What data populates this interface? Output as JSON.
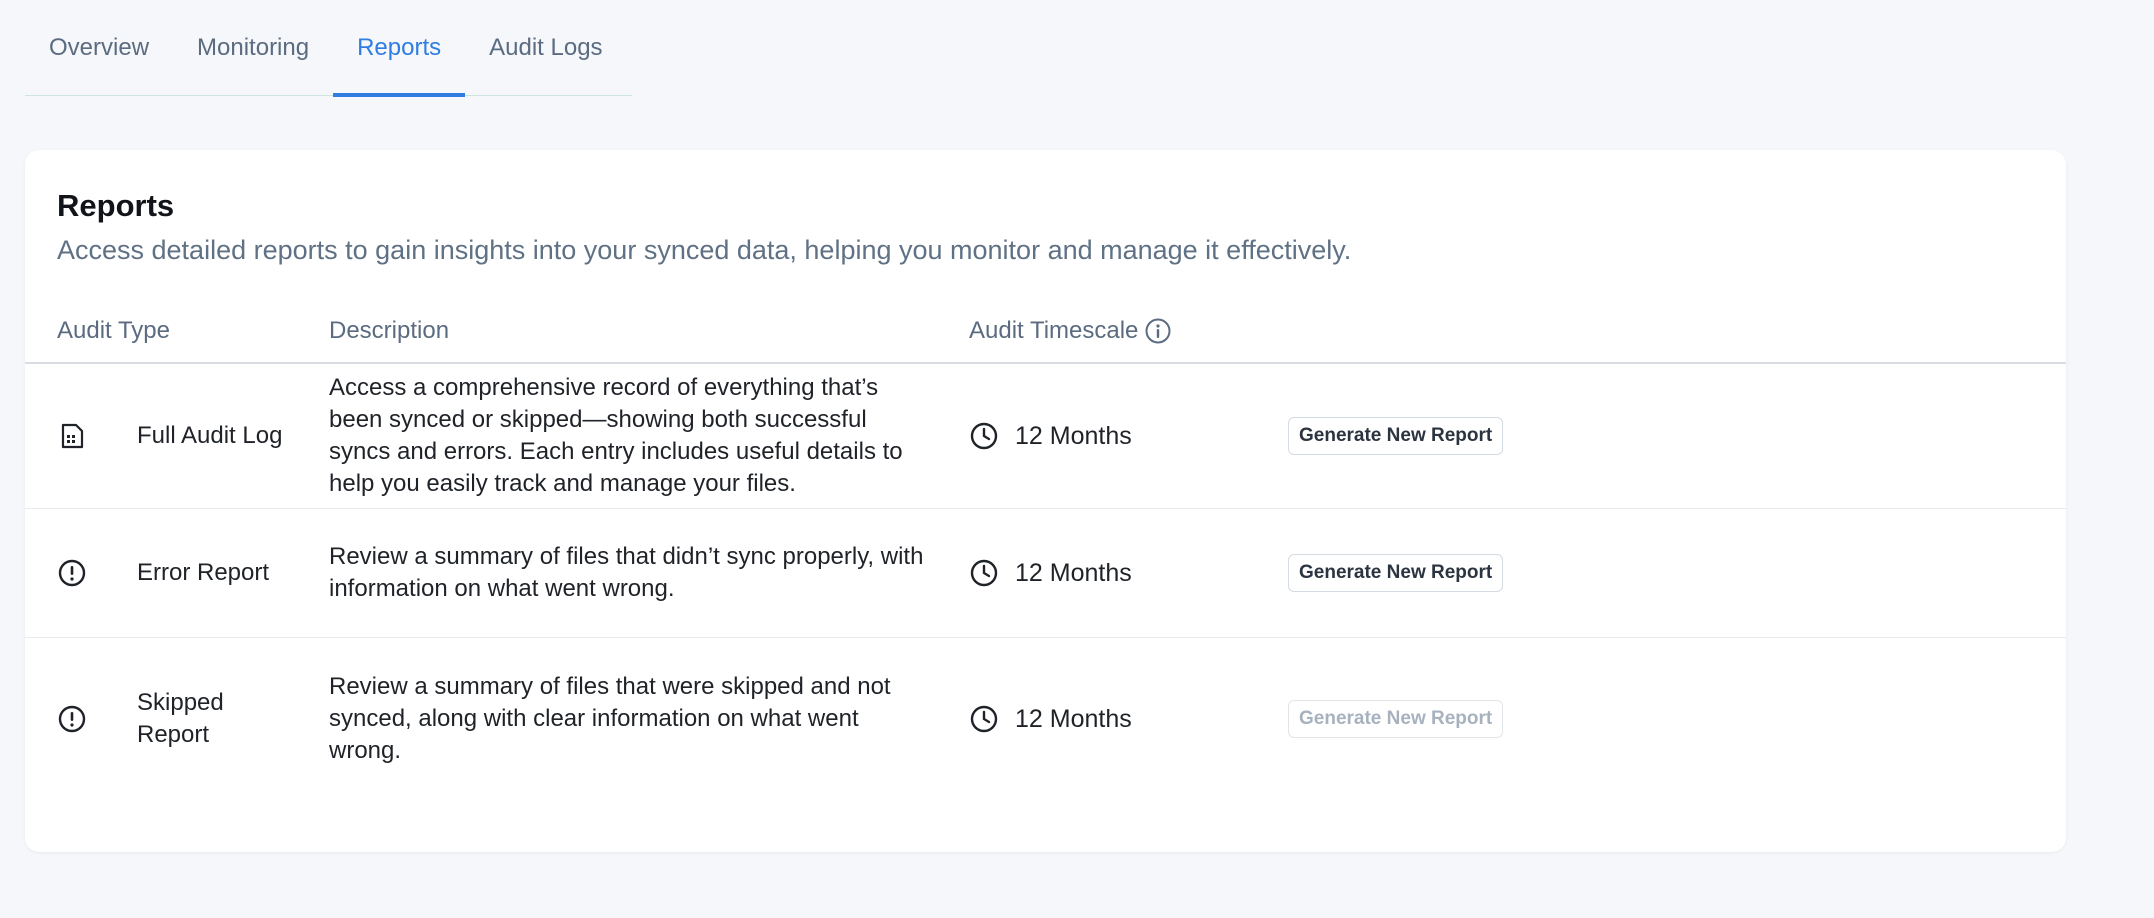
{
  "tabs": [
    {
      "label": "Overview",
      "active": false
    },
    {
      "label": "Monitoring",
      "active": false
    },
    {
      "label": "Reports",
      "active": true
    },
    {
      "label": "Audit Logs",
      "active": false
    }
  ],
  "card": {
    "title": "Reports",
    "subtitle": "Access detailed reports to gain insights into your synced data, helping you monitor and manage it effectively."
  },
  "table": {
    "headers": {
      "type": "Audit Type",
      "description": "Description",
      "timescale": "Audit Timescale"
    },
    "rows": [
      {
        "icon": "file-icon",
        "type": "Full Audit Log",
        "description": "Access a comprehensive record of everything that’s been synced or skipped—showing both successful syncs and errors. Each entry includes useful details to help you easily track and manage your files.",
        "timescale": "12 Months",
        "action": "Generate New Report",
        "action_enabled": true
      },
      {
        "icon": "alert-circle-icon",
        "type": "Error Report",
        "description": "Review a summary of files that didn’t sync properly, with information on what went wrong.",
        "timescale": "12 Months",
        "action": "Generate New Report",
        "action_enabled": true
      },
      {
        "icon": "alert-circle-icon",
        "type": "Skipped Report",
        "description": "Review a summary of files that were skipped and not synced, along with clear information on what went wrong.",
        "timescale": "12 Months",
        "action": "Generate New Report",
        "action_enabled": false
      }
    ]
  },
  "colors": {
    "accent": "#2f7de1",
    "muted_text": "#5b6b80",
    "disabled_text": "#a8b2bf",
    "background": "#f5f7fa"
  }
}
